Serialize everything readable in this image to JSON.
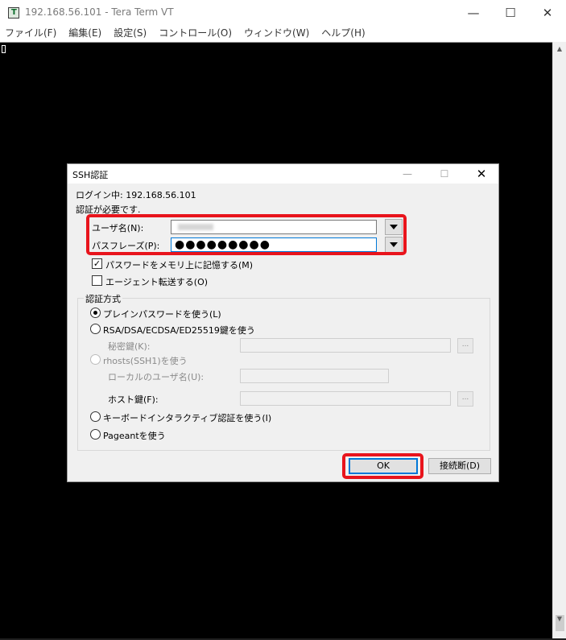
{
  "window": {
    "title": "192.168.56.101 - Tera Term VT",
    "icon_letter": "T",
    "controls": {
      "minimize": "—",
      "maximize": "☐",
      "close": "✕"
    }
  },
  "menu": [
    {
      "label": "ファイル(F)"
    },
    {
      "label": "編集(E)"
    },
    {
      "label": "設定(S)"
    },
    {
      "label": "コントロール(O)"
    },
    {
      "label": "ウィンドウ(W)"
    },
    {
      "label": "ヘルプ(H)"
    }
  ],
  "scrollbar": {
    "up": "▲",
    "down": "▼"
  },
  "dialog": {
    "title": "SSH認証",
    "controls": {
      "minimize": "—",
      "maximize": "☐",
      "close": "✕"
    },
    "login_line": "ログイン中: 192.168.56.101",
    "auth_required": "認証が必要です.",
    "username_label": "ユーザ名(N):",
    "passphrase_label": "パスフレーズ(P):",
    "passphrase_value": "●●●●●●●●●",
    "remember_password": {
      "label": "パスワードをメモリ上に記憶する(M)",
      "checked": true,
      "mark": "✓"
    },
    "agent_forwarding": {
      "label": "エージェント転送する(O)",
      "checked": false
    },
    "auth_method_label": "認証方式",
    "methods": {
      "plain_password": {
        "label": "プレインパスワードを使う(L)",
        "selected": true
      },
      "rsa": {
        "label": "RSA/DSA/ECDSA/ED25519鍵を使う",
        "selected": false
      },
      "private_key_label": "秘密鍵(K):",
      "rhosts": {
        "label": "rhosts(SSH1)を使う",
        "selected": false,
        "disabled": true
      },
      "local_user_label": "ローカルのユーザ名(U):",
      "host_key_label": "ホスト鍵(F):",
      "keyboard_interactive": {
        "label": "キーボードインタラクティブ認証を使う(I)",
        "selected": false
      },
      "pageant": {
        "label": "Pageantを使う",
        "selected": false
      }
    },
    "browse_label": "...",
    "ok_label": "OK",
    "disconnect_label": "接続断(D)"
  },
  "colors": {
    "highlight": "#e8141c",
    "focus_border": "#0078d7",
    "terminal_bg": "#000000"
  }
}
